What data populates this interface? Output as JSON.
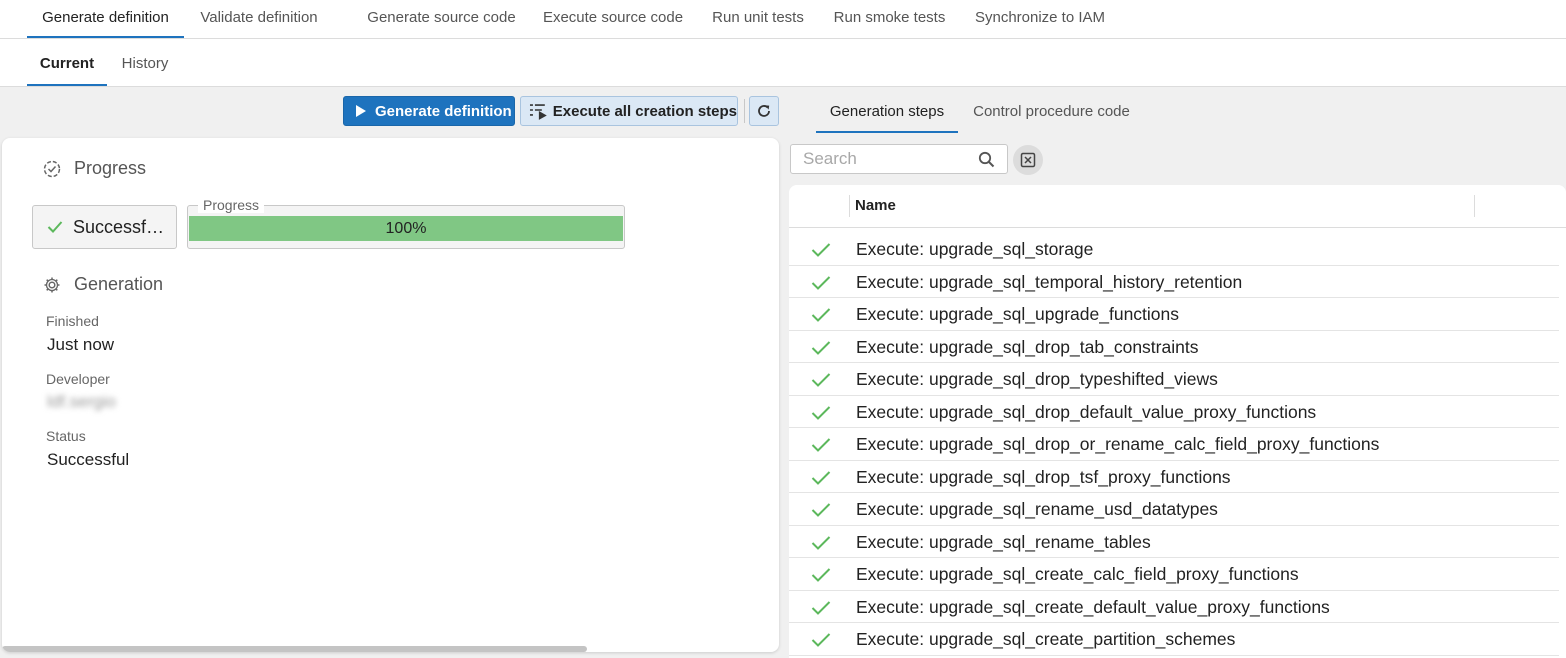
{
  "top_tabs": [
    {
      "label": "Generate definition",
      "active": true
    },
    {
      "label": "Validate definition",
      "active": false
    },
    {
      "label": "Generate source code",
      "active": false
    },
    {
      "label": "Execute source code",
      "active": false
    },
    {
      "label": "Run unit tests",
      "active": false
    },
    {
      "label": "Run smoke tests",
      "active": false
    },
    {
      "label": "Synchronize to IAM",
      "active": false
    }
  ],
  "sub_tabs": [
    {
      "label": "Current",
      "active": true
    },
    {
      "label": "History",
      "active": false
    }
  ],
  "toolbar": {
    "generate_label": "Generate definition",
    "execute_all_label": "Execute all creation steps",
    "refresh_icon": "refresh-icon"
  },
  "progress_section": {
    "title": "Progress",
    "status_text": "Successf…",
    "progress_legend": "Progress",
    "progress_value": 1.0,
    "progress_text": "100%"
  },
  "generation_section": {
    "title": "Generation",
    "finished_label": "Finished",
    "finished_value": "Just now",
    "developer_label": "Developer",
    "developer_value": "ldf.sergio",
    "status_label": "Status",
    "status_value": "Successful"
  },
  "right_tabs": [
    {
      "label": "Generation steps",
      "active": true
    },
    {
      "label": "Control procedure code",
      "active": false
    }
  ],
  "search": {
    "placeholder": "Search",
    "value": ""
  },
  "grid": {
    "column_name": "Name",
    "rows": [
      {
        "name": "Execute: upgrade_sql_storage",
        "status": "success"
      },
      {
        "name": "Execute: upgrade_sql_temporal_history_retention",
        "status": "success"
      },
      {
        "name": "Execute: upgrade_sql_upgrade_functions",
        "status": "success"
      },
      {
        "name": "Execute: upgrade_sql_drop_tab_constraints",
        "status": "success"
      },
      {
        "name": "Execute: upgrade_sql_drop_typeshifted_views",
        "status": "success"
      },
      {
        "name": "Execute: upgrade_sql_drop_default_value_proxy_functions",
        "status": "success"
      },
      {
        "name": "Execute: upgrade_sql_drop_or_rename_calc_field_proxy_functions",
        "status": "success"
      },
      {
        "name": "Execute: upgrade_sql_drop_tsf_proxy_functions",
        "status": "success"
      },
      {
        "name": "Execute: upgrade_sql_rename_usd_datatypes",
        "status": "success"
      },
      {
        "name": "Execute: upgrade_sql_rename_tables",
        "status": "success"
      },
      {
        "name": "Execute: upgrade_sql_create_calc_field_proxy_functions",
        "status": "success"
      },
      {
        "name": "Execute: upgrade_sql_create_default_value_proxy_functions",
        "status": "success"
      },
      {
        "name": "Execute: upgrade_sql_create_partition_schemes",
        "status": "success"
      }
    ]
  },
  "colors": {
    "accent": "#1e73be",
    "success": "#5cb85c",
    "progress_fill": "#80c784"
  }
}
